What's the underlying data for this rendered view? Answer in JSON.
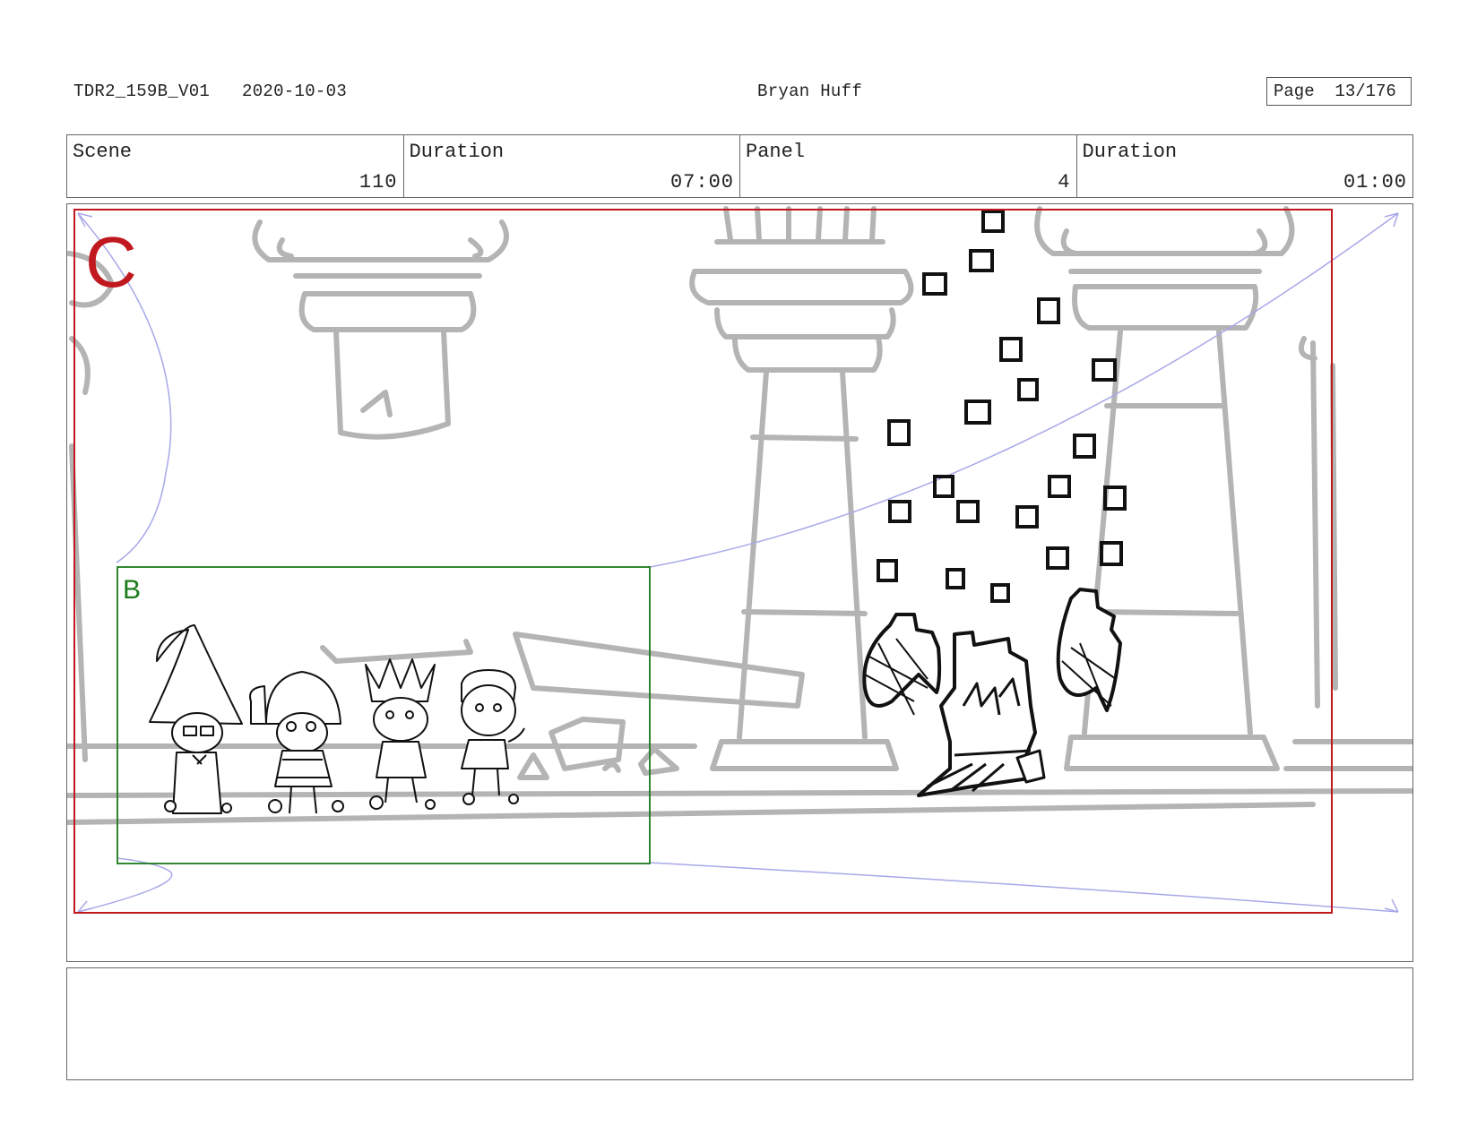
{
  "header": {
    "doc_id": "TDR2_159B_V01",
    "date": "2020-10-03",
    "artist": "Bryan Huff",
    "page": "Page  13/176"
  },
  "info": {
    "scene_label": "Scene",
    "scene_value": "110",
    "scene_duration_label": "Duration",
    "scene_duration_value": "07:00",
    "panel_label": "Panel",
    "panel_value": "4",
    "panel_duration_label": "Duration",
    "panel_duration_value": "01:00"
  },
  "frame": {
    "outer_label": "C",
    "inner_label": "B",
    "outer_color": "#c0181e",
    "inner_color": "#1a7a1a",
    "guide_color": "#a8a8e8"
  },
  "notes": {
    "text": ""
  }
}
